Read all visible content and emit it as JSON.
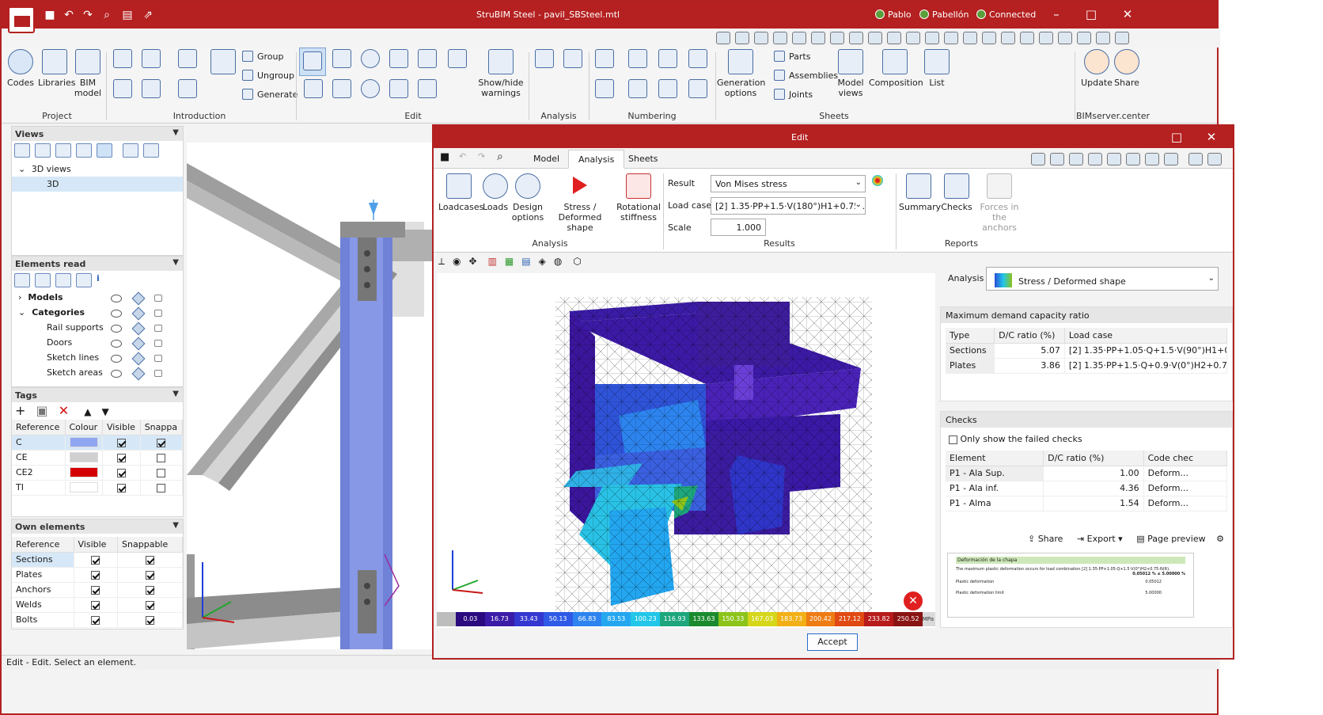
{
  "app": {
    "title": "StruBIM Steel - pavil_SBSteel.mtl",
    "users": [
      "Pablo",
      "Pabellón",
      "Connected"
    ],
    "status": "Edit - Edit. Select an element."
  },
  "ribbon": {
    "project": {
      "label": "Project",
      "items": [
        "Codes",
        "Libraries",
        "BIM model"
      ]
    },
    "introduction": {
      "label": "Introduction",
      "small": [
        "Group",
        "Ungroup",
        "Generate"
      ]
    },
    "edit": {
      "label": "Edit",
      "showhide": "Show/hide warnings"
    },
    "analysis": {
      "label": "Analysis"
    },
    "numbering": {
      "label": "Numbering"
    },
    "sheets": {
      "label": "Sheets",
      "items": [
        "Generation options",
        "Model views",
        "Composition",
        "List"
      ],
      "small": [
        "Parts",
        "Assemblies",
        "Joints"
      ]
    },
    "bimserver": {
      "label": "BIMserver.center",
      "items": [
        "Update",
        "Share"
      ]
    }
  },
  "views": {
    "title": "Views",
    "group": "3D views",
    "item": "3D"
  },
  "elements_read": {
    "title": "Elements read",
    "models": "Models",
    "categories": "Categories",
    "items": [
      "Rail supports",
      "Doors",
      "Sketch lines",
      "Sketch areas"
    ]
  },
  "tags": {
    "title": "Tags",
    "columns": [
      "Reference",
      "Colour",
      "Visible",
      "Snappa"
    ],
    "rows": [
      {
        "ref": "C",
        "color": "#8fa6f0",
        "visible": true,
        "snap": true
      },
      {
        "ref": "CE",
        "color": "#d0d0d0",
        "visible": true,
        "snap": false
      },
      {
        "ref": "CE2",
        "color": "#d40000",
        "visible": true,
        "snap": false
      },
      {
        "ref": "TI",
        "color": "#ffffff",
        "visible": true,
        "snap": false
      }
    ]
  },
  "own_elements": {
    "title": "Own elements",
    "columns": [
      "Reference",
      "Visible",
      "Snappable"
    ],
    "rows": [
      "Sections",
      "Plates",
      "Anchors",
      "Welds",
      "Bolts"
    ]
  },
  "edit_dialog": {
    "title": "Edit",
    "tabs": [
      "Model",
      "Analysis",
      "Sheets"
    ],
    "analysis_group": {
      "label": "Analysis",
      "items": [
        "Loadcases",
        "Loads",
        "Design options",
        "Stress / Deformed shape",
        "Rotational stiffness"
      ]
    },
    "results_group": {
      "label": "Results",
      "result_label": "Result",
      "result_value": "Von Mises stress",
      "loadcase_label": "Load case",
      "loadcase_value": "[2] 1.35·PP+1.5·V(180°)H1+0.75...",
      "scale_label": "Scale",
      "scale_value": "1.000"
    },
    "reports_group": {
      "label": "Reports",
      "items": [
        "Summary",
        "Checks",
        "Forces in the anchors"
      ]
    },
    "analysis_selector": {
      "label": "Analysis",
      "value": "Stress / Deformed shape"
    },
    "max_dcr": {
      "title": "Maximum demand capacity ratio",
      "columns": [
        "Type",
        "D/C ratio (%)",
        "Load case"
      ],
      "rows": [
        {
          "type": "Sections",
          "ratio": "5.07",
          "case": "[2] 1.35·PP+1.05·Q+1.5·V(90°)H1+0.75·"
        },
        {
          "type": "Plates",
          "ratio": "3.86",
          "case": "[2] 1.35·PP+1.5·Q+0.9·V(0°)H2+0.75·N("
        }
      ]
    },
    "checks": {
      "title": "Checks",
      "filter": "Only show the failed checks",
      "columns": [
        "Element",
        "D/C ratio (%)",
        "Code chec"
      ],
      "rows": [
        {
          "el": "P1 - Ala Sup.",
          "ratio": "1.00",
          "code": "Deform..."
        },
        {
          "el": "P1 - Ala inf.",
          "ratio": "4.36",
          "code": "Deform..."
        },
        {
          "el": "P1 - Alma",
          "ratio": "1.54",
          "code": "Deform..."
        }
      ],
      "actions": [
        "Share",
        "Export",
        "Page preview"
      ]
    },
    "preview": {
      "heading": "Deformación de la chapa",
      "line1": "The maximum plastic deformation occurs for load combination [2] 1.35·PP+1.05·Q+1.5·V(0°)H2+0.75·N(R).",
      "value1": "0.05012 % ≤ 5.00000 %",
      "label2": "Plastic deformation",
      "value2": "0.05012",
      "label3": "Plastic deformation limit",
      "value3": "5.00000"
    },
    "legend": {
      "values": [
        "0.03",
        "16.73",
        "33.43",
        "50.13",
        "66.83",
        "83.53",
        "100.23",
        "116.93",
        "133.63",
        "150.33",
        "167.03",
        "183.73",
        "200.42",
        "217.12",
        "233.82",
        "250.52"
      ],
      "colors": [
        "#2a0a7e",
        "#3b1ca8",
        "#3437d0",
        "#2f5ae6",
        "#2d84ef",
        "#25a7f0",
        "#22c6e8",
        "#1ea67c",
        "#1b8a2e",
        "#8cc41b",
        "#d6d61a",
        "#f2b016",
        "#ee7c13",
        "#e04a12",
        "#b81b1b",
        "#8a1414"
      ],
      "unit": "MPa"
    },
    "accept": "Accept"
  }
}
